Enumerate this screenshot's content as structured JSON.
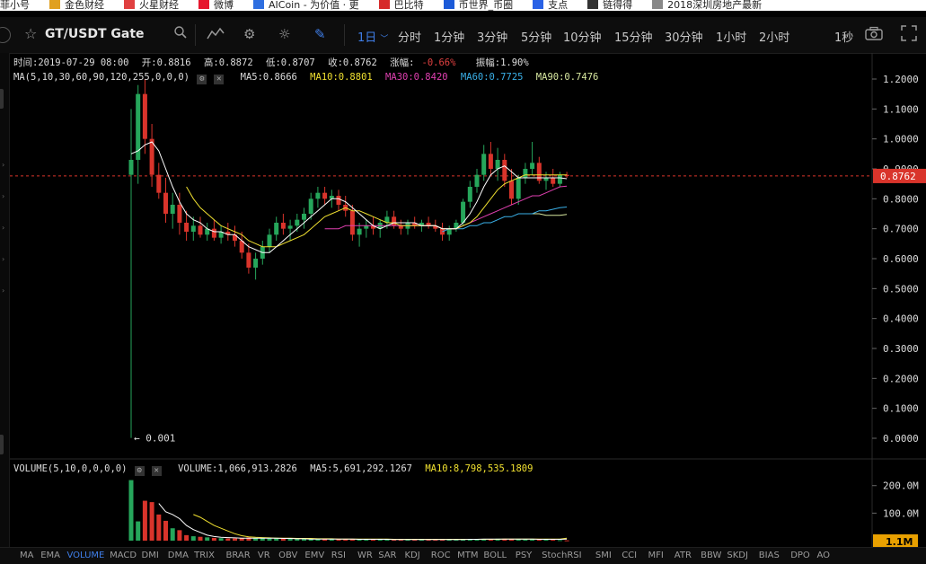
{
  "bookmarks": [
    {
      "label": "菲小号",
      "icon": "page-icon",
      "color": "#888888"
    },
    {
      "label": "金色财经",
      "icon": "gold-logo-icon",
      "color": "#e0a020"
    },
    {
      "label": "火星财经",
      "icon": "check-logo-icon",
      "color": "#e04040"
    },
    {
      "label": "微博",
      "icon": "weibo-icon",
      "color": "#e6162d"
    },
    {
      "label": "AICoin - 为价值 · 更",
      "icon": "aicoin-icon",
      "color": "#2f6fe0"
    },
    {
      "label": "巴比特",
      "icon": "babit-icon",
      "color": "#d62a2a"
    },
    {
      "label": "币世界_币圈",
      "icon": "bishijie-icon",
      "color": "#1d5bd8"
    },
    {
      "label": "支点",
      "icon": "zhidian-icon",
      "color": "#2a62e6"
    },
    {
      "label": "链得得",
      "icon": "lianded-icon",
      "color": "#333333"
    },
    {
      "label": "2018深圳房地产最新",
      "icon": "page-icon",
      "color": "#888888"
    }
  ],
  "toolbar": {
    "symbol": "GT/USDT Gate",
    "interval_selected": "1日",
    "periods": [
      "分时",
      "1分钟",
      "3分钟",
      "5分钟",
      "10分钟",
      "15分钟",
      "30分钟",
      "1小时",
      "2小时"
    ],
    "refresh_label": "1秒"
  },
  "info": {
    "time": "时间:2019-07-29 08:00",
    "open": "开:0.8816",
    "high": "高:0.8872",
    "low": "低:0.8707",
    "close": "收:0.8762",
    "change_label": "涨幅:",
    "change_value": "-0.66%",
    "amplitude": "振幅:1.90%",
    "ma_params": "MA(5,10,30,60,90,120,255,0,0,0)",
    "ma5": "MA5:0.8666",
    "ma10": "MA10:0.8801",
    "ma30": "MA30:0.8420",
    "ma60": "MA60:0.7725",
    "ma90": "MA90:0.7476",
    "vol_params": "VOLUME(5,10,0,0,0,0)",
    "volume": "VOLUME:1,066,913.2826",
    "vol_ma5": "MA5:5,691,292.1267",
    "vol_ma10": "MA10:8,798,535.1809"
  },
  "colors": {
    "up": "#26a65b",
    "down": "#d9342b",
    "ma5": "#ffffff",
    "ma10": "#f0e030",
    "ma30": "#e040b0",
    "ma60": "#3ab0e8",
    "ma90": "#d8e8a0",
    "price_line": "#d9342b",
    "accent": "#3f7ee8",
    "vol_marker": "#e8a000"
  },
  "indicators": [
    "MA",
    "EMA",
    "VOLUME",
    "MACD",
    "DMI",
    "DMA",
    "TRIX",
    "BRAR",
    "VR",
    "OBV",
    "EMV",
    "RSI",
    "WR",
    "SAR",
    "KDJ",
    "ROC",
    "MTM",
    "BOLL",
    "PSY",
    "StochRSI",
    "SMI",
    "CCI",
    "MFI",
    "ATR",
    "BBW",
    "SKDJ",
    "BIAS",
    "DPO",
    "AO"
  ],
  "indicator_active": "VOLUME",
  "chart_data": {
    "type": "candlestick",
    "interval": "1日",
    "price_axis": {
      "min": 0.0,
      "max": 1.2,
      "step": 0.1,
      "ticks": [
        "1.2000",
        "1.1000",
        "1.0000",
        "0.9000",
        "0.8000",
        "0.7000",
        "0.6000",
        "0.5000",
        "0.4000",
        "0.3000",
        "0.2000",
        "0.1000",
        "0.0000"
      ]
    },
    "current_price": 0.8762,
    "current_price_label": "0.8762",
    "low_marker": {
      "value": 0.001,
      "label": "← 0.001"
    },
    "volume_axis": {
      "ticks": [
        "200.0M",
        "100.0M"
      ],
      "tick_values": [
        200,
        100
      ],
      "unit": "M"
    },
    "current_volume_label": "1.1M",
    "ohlc": [
      [
        0.88,
        1.1,
        0.001,
        0.93
      ],
      [
        0.93,
        1.18,
        0.85,
        1.15
      ],
      [
        1.15,
        1.2,
        0.95,
        1.0
      ],
      [
        1.0,
        1.05,
        0.84,
        0.88
      ],
      [
        0.88,
        0.92,
        0.8,
        0.82
      ],
      [
        0.82,
        0.87,
        0.72,
        0.75
      ],
      [
        0.75,
        0.82,
        0.7,
        0.78
      ],
      [
        0.78,
        0.82,
        0.68,
        0.72
      ],
      [
        0.72,
        0.76,
        0.66,
        0.69
      ],
      [
        0.69,
        0.74,
        0.66,
        0.71
      ],
      [
        0.71,
        0.74,
        0.67,
        0.68
      ],
      [
        0.68,
        0.72,
        0.66,
        0.7
      ],
      [
        0.7,
        0.73,
        0.66,
        0.67
      ],
      [
        0.67,
        0.71,
        0.65,
        0.69
      ],
      [
        0.69,
        0.72,
        0.66,
        0.68
      ],
      [
        0.68,
        0.71,
        0.64,
        0.66
      ],
      [
        0.66,
        0.69,
        0.6,
        0.62
      ],
      [
        0.62,
        0.65,
        0.55,
        0.57
      ],
      [
        0.57,
        0.62,
        0.53,
        0.6
      ],
      [
        0.6,
        0.66,
        0.58,
        0.64
      ],
      [
        0.64,
        0.7,
        0.62,
        0.68
      ],
      [
        0.68,
        0.74,
        0.66,
        0.72
      ],
      [
        0.72,
        0.75,
        0.68,
        0.7
      ],
      [
        0.7,
        0.73,
        0.66,
        0.71
      ],
      [
        0.71,
        0.75,
        0.69,
        0.73
      ],
      [
        0.73,
        0.77,
        0.7,
        0.75
      ],
      [
        0.75,
        0.82,
        0.73,
        0.8
      ],
      [
        0.8,
        0.84,
        0.77,
        0.82
      ],
      [
        0.82,
        0.84,
        0.78,
        0.8
      ],
      [
        0.8,
        0.83,
        0.77,
        0.81
      ],
      [
        0.81,
        0.83,
        0.76,
        0.78
      ],
      [
        0.78,
        0.81,
        0.74,
        0.76
      ],
      [
        0.76,
        0.78,
        0.66,
        0.68
      ],
      [
        0.68,
        0.72,
        0.64,
        0.7
      ],
      [
        0.7,
        0.73,
        0.67,
        0.71
      ],
      [
        0.71,
        0.74,
        0.68,
        0.7
      ],
      [
        0.7,
        0.73,
        0.67,
        0.72
      ],
      [
        0.72,
        0.76,
        0.7,
        0.74
      ],
      [
        0.74,
        0.76,
        0.7,
        0.71
      ],
      [
        0.71,
        0.73,
        0.68,
        0.7
      ],
      [
        0.7,
        0.73,
        0.68,
        0.72
      ],
      [
        0.72,
        0.74,
        0.7,
        0.71
      ],
      [
        0.71,
        0.73,
        0.69,
        0.72
      ],
      [
        0.72,
        0.74,
        0.7,
        0.71
      ],
      [
        0.71,
        0.73,
        0.69,
        0.7
      ],
      [
        0.7,
        0.72,
        0.66,
        0.68
      ],
      [
        0.68,
        0.71,
        0.66,
        0.7
      ],
      [
        0.7,
        0.73,
        0.69,
        0.72
      ],
      [
        0.72,
        0.8,
        0.71,
        0.79
      ],
      [
        0.79,
        0.86,
        0.77,
        0.84
      ],
      [
        0.84,
        0.9,
        0.82,
        0.88
      ],
      [
        0.88,
        0.98,
        0.86,
        0.95
      ],
      [
        0.95,
        0.99,
        0.88,
        0.9
      ],
      [
        0.9,
        0.97,
        0.86,
        0.93
      ],
      [
        0.93,
        0.95,
        0.84,
        0.86
      ],
      [
        0.86,
        0.9,
        0.78,
        0.8
      ],
      [
        0.8,
        0.88,
        0.78,
        0.87
      ],
      [
        0.87,
        0.92,
        0.85,
        0.9
      ],
      [
        0.9,
        0.99,
        0.88,
        0.92
      ],
      [
        0.92,
        0.94,
        0.85,
        0.86
      ],
      [
        0.86,
        0.89,
        0.83,
        0.87
      ],
      [
        0.87,
        0.9,
        0.84,
        0.85
      ],
      [
        0.85,
        0.89,
        0.84,
        0.88
      ],
      [
        0.88,
        0.89,
        0.87,
        0.876
      ]
    ],
    "ma5": [
      0.95,
      0.96,
      0.98,
      0.99,
      0.96,
      0.9,
      0.84,
      0.79,
      0.75,
      0.73,
      0.72,
      0.7,
      0.69,
      0.69,
      0.68,
      0.68,
      0.66,
      0.64,
      0.63,
      0.62,
      0.62,
      0.64,
      0.66,
      0.68,
      0.7,
      0.72,
      0.74,
      0.76,
      0.78,
      0.8,
      0.8,
      0.79,
      0.77,
      0.75,
      0.73,
      0.71,
      0.7,
      0.71,
      0.72,
      0.72,
      0.72,
      0.72,
      0.71,
      0.71,
      0.71,
      0.7,
      0.7,
      0.7,
      0.72,
      0.75,
      0.79,
      0.84,
      0.88,
      0.9,
      0.91,
      0.89,
      0.87,
      0.87,
      0.87,
      0.87,
      0.87,
      0.87,
      0.87,
      0.867
    ],
    "ma10": [
      null,
      null,
      null,
      null,
      null,
      null,
      null,
      null,
      0.84,
      0.8,
      0.77,
      0.75,
      0.73,
      0.71,
      0.7,
      0.69,
      0.68,
      0.66,
      0.65,
      0.64,
      0.64,
      0.64,
      0.65,
      0.66,
      0.67,
      0.68,
      0.7,
      0.72,
      0.74,
      0.75,
      0.76,
      0.77,
      0.76,
      0.76,
      0.75,
      0.74,
      0.73,
      0.72,
      0.72,
      0.71,
      0.71,
      0.71,
      0.71,
      0.71,
      0.71,
      0.7,
      0.7,
      0.7,
      0.71,
      0.72,
      0.74,
      0.77,
      0.8,
      0.83,
      0.85,
      0.86,
      0.87,
      0.88,
      0.88,
      0.88,
      0.88,
      0.88,
      0.88,
      0.88
    ],
    "ma30": [
      null,
      null,
      null,
      null,
      null,
      null,
      null,
      null,
      null,
      null,
      null,
      null,
      null,
      null,
      null,
      null,
      null,
      null,
      null,
      null,
      null,
      null,
      null,
      null,
      null,
      null,
      null,
      null,
      0.7,
      0.7,
      0.7,
      0.71,
      0.71,
      0.71,
      0.71,
      0.71,
      0.71,
      0.71,
      0.71,
      0.71,
      0.71,
      0.71,
      0.71,
      0.71,
      0.71,
      0.7,
      0.7,
      0.7,
      0.71,
      0.72,
      0.73,
      0.74,
      0.75,
      0.76,
      0.77,
      0.78,
      0.79,
      0.8,
      0.81,
      0.81,
      0.82,
      0.83,
      0.84,
      0.842
    ],
    "ma60": [
      null,
      null,
      null,
      null,
      null,
      null,
      null,
      null,
      null,
      null,
      null,
      null,
      null,
      null,
      null,
      null,
      null,
      null,
      null,
      null,
      null,
      null,
      null,
      null,
      null,
      null,
      null,
      null,
      null,
      null,
      null,
      null,
      null,
      null,
      null,
      null,
      null,
      null,
      null,
      null,
      null,
      null,
      null,
      null,
      null,
      0.69,
      0.7,
      0.7,
      0.7,
      0.71,
      0.71,
      0.72,
      0.72,
      0.73,
      0.74,
      0.74,
      0.75,
      0.75,
      0.75,
      0.76,
      0.76,
      0.765,
      0.77,
      0.7725
    ],
    "ma90": [
      null,
      null,
      null,
      null,
      null,
      null,
      null,
      null,
      null,
      null,
      null,
      null,
      null,
      null,
      null,
      null,
      null,
      null,
      null,
      null,
      null,
      null,
      null,
      null,
      null,
      null,
      null,
      null,
      null,
      null,
      null,
      null,
      null,
      null,
      null,
      null,
      null,
      null,
      null,
      null,
      null,
      null,
      null,
      null,
      null,
      null,
      null,
      null,
      null,
      null,
      null,
      null,
      null,
      null,
      null,
      null,
      0.75,
      0.75,
      0.75,
      0.75,
      0.745,
      0.745,
      0.745,
      0.7476
    ],
    "volume": [
      220,
      70,
      145,
      140,
      95,
      72,
      45,
      38,
      20,
      16,
      14,
      12,
      10,
      9,
      8,
      8,
      9,
      12,
      10,
      9,
      8,
      8,
      7,
      7,
      6,
      6,
      7,
      7,
      6,
      6,
      5,
      5,
      6,
      5,
      5,
      5,
      4,
      4,
      4,
      4,
      4,
      4,
      4,
      4,
      4,
      4,
      4,
      4,
      5,
      6,
      6,
      6,
      6,
      7,
      7,
      6,
      5,
      5,
      5,
      4,
      4,
      3,
      2,
      1.1
    ],
    "volume_ma5": [
      null,
      null,
      null,
      null,
      135,
      105,
      95,
      80,
      55,
      40,
      30,
      20,
      15,
      12,
      11,
      10,
      9,
      9,
      9,
      9,
      9,
      9,
      8,
      8,
      7,
      7,
      6,
      6,
      6,
      6,
      6,
      6,
      6,
      5,
      5,
      5,
      5,
      5,
      4,
      4,
      4,
      4,
      4,
      4,
      4,
      4,
      4,
      4,
      4,
      5,
      5,
      6,
      6,
      6,
      6,
      6,
      6,
      6,
      6,
      5,
      5,
      5,
      5,
      5.69
    ],
    "volume_ma10": [
      null,
      null,
      null,
      null,
      null,
      null,
      null,
      null,
      null,
      95,
      85,
      70,
      55,
      45,
      35,
      25,
      18,
      14,
      12,
      11,
      10,
      9,
      9,
      9,
      8,
      8,
      8,
      7,
      7,
      7,
      6,
      6,
      6,
      6,
      6,
      6,
      6,
      6,
      5,
      5,
      5,
      5,
      5,
      5,
      5,
      5,
      5,
      5,
      5,
      5,
      5,
      5,
      5,
      5,
      6,
      6,
      6,
      6,
      6,
      6,
      6,
      6,
      6,
      8.8
    ]
  }
}
